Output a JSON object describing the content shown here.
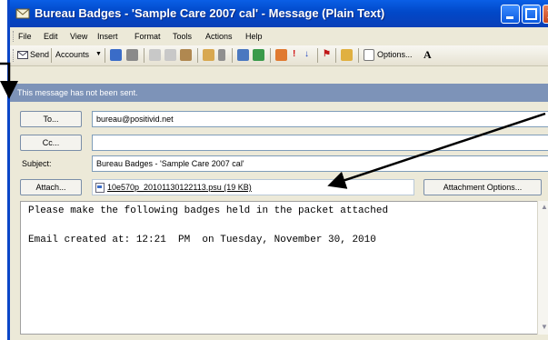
{
  "window": {
    "title": "Bureau Badges - 'Sample Care 2007 cal' - Message (Plain Text)"
  },
  "menu": {
    "items": [
      "File",
      "Edit",
      "View",
      "Insert",
      "Format",
      "Tools",
      "Actions",
      "Help"
    ]
  },
  "toolbar": {
    "send_label": "Send",
    "accounts_label": "Accounts",
    "options_label": "Options...",
    "font_label": "A"
  },
  "infobar": {
    "text": "This message has not been sent."
  },
  "headers": {
    "to_label": "To...",
    "to_value": "bureau@positivid.net",
    "cc_label": "Cc...",
    "cc_value": "",
    "subject_label": "Subject:",
    "subject_value": "Bureau Badges - 'Sample Care 2007 cal'",
    "attach_label": "Attach...",
    "attachment_name": "10e570p_20101130122113.psu (19 KB)",
    "attachment_options_label": "Attachment Options..."
  },
  "body": {
    "line1": "Please make the following badges held in the packet attached",
    "line2": "Email created at: 12:21  PM  on Tuesday, November 30, 2010"
  },
  "colors": {
    "titlebar": "#0a5fe6",
    "infobar": "#7d93b8",
    "annotation_arrows": "#000000"
  }
}
